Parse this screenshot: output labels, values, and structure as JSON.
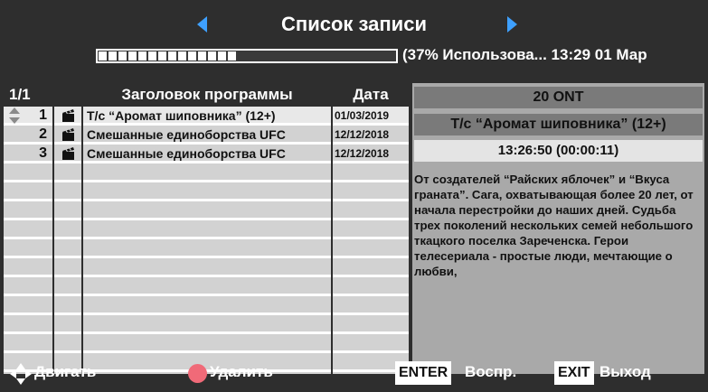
{
  "header": {
    "title": "Список записи",
    "usage_text": "(37% Использова... 13:29  01 Мар",
    "usage_fraction": 0.37,
    "accent_color": "#3ea0ff"
  },
  "table": {
    "headers": {
      "page": "1/1",
      "title": "Заголовок программы",
      "date": "Дата"
    },
    "rows": [
      {
        "num": "1",
        "title": "Т/с “Аромат шиповника” (12+)",
        "date": "01/03/2019",
        "selected": true
      },
      {
        "num": "2",
        "title": "Смешанные единоборства UFC",
        "date": "12/12/2018",
        "selected": false
      },
      {
        "num": "3",
        "title": "Смешанные единоборства UFC",
        "date": "12/12/2018",
        "selected": false
      }
    ]
  },
  "detail": {
    "channel": "20 ONT",
    "program": "Т/с “Аромат шиповника” (12+)",
    "time": "13:26:50 (00:00:11)",
    "description": "От создателей “Райских яблочек” и “Вкуса граната”. Сага, охватывающая более 20 лет, от начала перестройки до наших дней. Судьба трех поколений нескольких семей небольшого ткацкого поселка Зареченска. Герои телесериала - простые люди, мечтающие о любви,"
  },
  "footer": {
    "move_label": "Двигать",
    "delete_label": "Удалить",
    "enter_key": "ENTER",
    "enter_label": "Воспр.",
    "exit_key": "EXIT",
    "exit_label": "Выход",
    "delete_color": "#f06a78"
  }
}
